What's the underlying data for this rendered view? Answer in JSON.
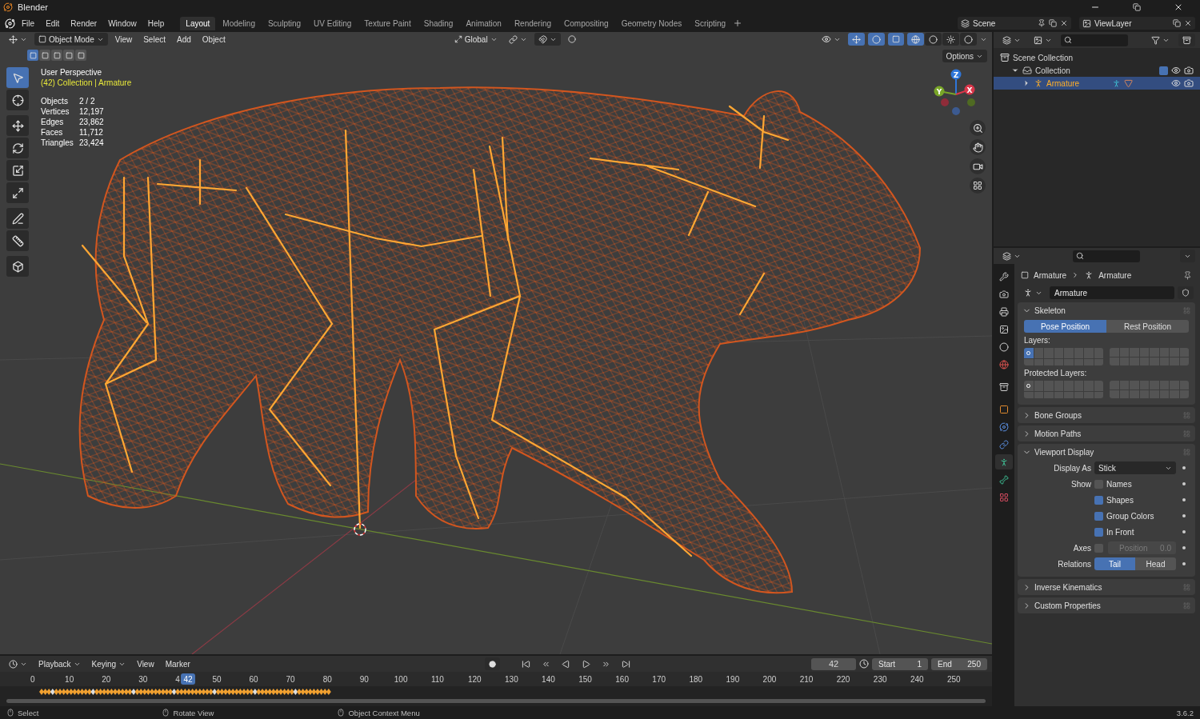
{
  "window": {
    "title": "Blender"
  },
  "menu": [
    "File",
    "Edit",
    "Render",
    "Window",
    "Help"
  ],
  "workspaces": [
    {
      "label": "Layout",
      "selected": true
    },
    {
      "label": "Modeling",
      "selected": false
    },
    {
      "label": "Sculpting",
      "selected": false
    },
    {
      "label": "UV Editing",
      "selected": false
    },
    {
      "label": "Texture Paint",
      "selected": false
    },
    {
      "label": "Shading",
      "selected": false
    },
    {
      "label": "Animation",
      "selected": false
    },
    {
      "label": "Rendering",
      "selected": false
    },
    {
      "label": "Compositing",
      "selected": false
    },
    {
      "label": "Geometry Nodes",
      "selected": false
    },
    {
      "label": "Scripting",
      "selected": false
    }
  ],
  "scene": {
    "name": "Scene"
  },
  "view_layer": {
    "name": "ViewLayer"
  },
  "viewport": {
    "mode": "Object Mode",
    "menus": [
      "View",
      "Select",
      "Add",
      "Object"
    ],
    "orientation": "Global",
    "options": "Options",
    "select_modes": [
      {
        "selected": true
      },
      {
        "selected": false
      },
      {
        "selected": false
      },
      {
        "selected": false
      },
      {
        "selected": false
      }
    ],
    "shading_modes": [
      {
        "kind": "wireframe",
        "selected": true
      },
      {
        "kind": "solid",
        "selected": false
      },
      {
        "kind": "material",
        "selected": false
      },
      {
        "kind": "rendered",
        "selected": false
      }
    ],
    "view_name": "User Perspective",
    "context": "(42) Collection | Armature",
    "stats": [
      {
        "label": "Objects",
        "value": "2 / 2"
      },
      {
        "label": "Vertices",
        "value": "12,197"
      },
      {
        "label": "Edges",
        "value": "23,862"
      },
      {
        "label": "Faces",
        "value": "11,712"
      },
      {
        "label": "Triangles",
        "value": "23,424"
      }
    ],
    "tools": [
      {
        "kind": "select",
        "selected": true
      },
      {
        "kind": "cursor",
        "selected": false
      },
      {
        "kind": "move",
        "selected": false
      },
      {
        "kind": "rotate",
        "selected": false
      },
      {
        "kind": "scale",
        "selected": false
      },
      {
        "kind": "transform",
        "selected": false
      },
      {
        "kind": "annotate",
        "selected": false
      },
      {
        "kind": "measure",
        "selected": false
      },
      {
        "kind": "add_cube",
        "selected": false
      }
    ],
    "gizmo_axes": [
      {
        "label": "Z",
        "color": "#2f76d9"
      },
      {
        "label": "Y",
        "color": "#79a628"
      },
      {
        "label": "X",
        "color": "#d9364a"
      }
    ]
  },
  "outliner": {
    "items": [
      {
        "label": "Scene Collection",
        "kind": "scene",
        "selected": false,
        "children": [
          {
            "label": "Collection",
            "kind": "collection",
            "selected": false,
            "expanded": true,
            "checked": true,
            "children": [
              {
                "label": "Armature",
                "kind": "armature",
                "selected": true,
                "expanded": false
              }
            ]
          }
        ]
      }
    ]
  },
  "properties": {
    "tabs": [
      {
        "kind": "tool",
        "selected": false
      },
      {
        "kind": "render",
        "selected": false
      },
      {
        "kind": "output",
        "selected": false
      },
      {
        "kind": "view_layer",
        "selected": false
      },
      {
        "kind": "scene",
        "selected": false
      },
      {
        "kind": "world",
        "selected": false
      },
      {
        "kind": "collection",
        "selected": false
      },
      {
        "kind": "object",
        "selected": false
      },
      {
        "kind": "physics",
        "selected": false
      },
      {
        "kind": "constraints",
        "selected": false
      },
      {
        "kind": "data",
        "selected": true
      },
      {
        "kind": "bone",
        "selected": false
      },
      {
        "kind": "texture",
        "selected": false
      }
    ],
    "breadcrumb": [
      "Armature",
      "Armature"
    ],
    "datablock": "Armature",
    "panels": [
      {
        "kind": "skeleton",
        "title": "Skeleton",
        "expanded": true,
        "positions": [
          {
            "label": "Pose Position",
            "selected": true
          },
          {
            "label": "Rest Position",
            "selected": false
          }
        ],
        "layers": {
          "label": "Layers:",
          "first_active": true,
          "first_has_bones": true
        },
        "protected_layers": {
          "label": "Protected Layers:",
          "first_active": false,
          "first_has_bones": true
        }
      },
      {
        "kind": "plain",
        "title": "Bone Groups",
        "expanded": false
      },
      {
        "kind": "plain",
        "title": "Motion Paths",
        "expanded": false
      },
      {
        "kind": "display",
        "title": "Viewport Display",
        "expanded": true,
        "display_as": {
          "label": "Display As",
          "value": "Stick"
        },
        "show_label": "Show",
        "show": [
          {
            "label": "Names",
            "checked": false
          },
          {
            "label": "Shapes",
            "checked": true
          },
          {
            "label": "Group Colors",
            "checked": true
          },
          {
            "label": "In Front",
            "checked": true
          }
        ],
        "axes": {
          "label": "Axes",
          "checked": false,
          "field_label": "Position",
          "value": "0.0",
          "disabled": true
        },
        "relations": {
          "label": "Relations",
          "options": [
            {
              "label": "Tail",
              "selected": true
            },
            {
              "label": "Head",
              "selected": false
            }
          ]
        }
      },
      {
        "kind": "plain",
        "title": "Inverse Kinematics",
        "expanded": false
      },
      {
        "kind": "plain",
        "title": "Custom Properties",
        "expanded": false
      }
    ]
  },
  "timeline": {
    "menus": [
      "Playback",
      "Keying",
      "View",
      "Marker"
    ],
    "current_frame": "42",
    "start": {
      "label": "Start",
      "value": "1"
    },
    "end": {
      "label": "End",
      "value": "250"
    },
    "ticks": [
      "0",
      "10",
      "20",
      "30",
      "4",
      "50",
      "60",
      "70",
      "80",
      "90",
      "100",
      "110",
      "120",
      "130",
      "140",
      "150",
      "160",
      "170",
      "180",
      "190",
      "200",
      "210",
      "220",
      "230",
      "240",
      "250"
    ],
    "marker": "42"
  },
  "status_bar": {
    "items": [
      "Select",
      "Rotate View",
      "Object Context Menu"
    ],
    "version": "3.6.2"
  }
}
